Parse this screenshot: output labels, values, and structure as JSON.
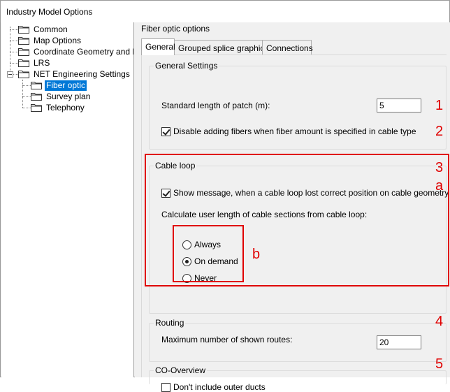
{
  "window": {
    "title": "Industry Model Options"
  },
  "tree": {
    "items": [
      {
        "label": "Common"
      },
      {
        "label": "Map Options"
      },
      {
        "label": "Coordinate Geometry and Dime"
      },
      {
        "label": "LRS"
      },
      {
        "label": "NET Engineering Settings"
      },
      {
        "label": "Fiber optic"
      },
      {
        "label": "Survey plan"
      },
      {
        "label": "Telephony"
      }
    ]
  },
  "pane": {
    "group_title": "Fiber optic options",
    "tabs": [
      {
        "label": "General"
      },
      {
        "label": "Grouped splice graphics"
      },
      {
        "label": "Connections"
      }
    ],
    "active_tab": "General"
  },
  "general_settings": {
    "title": "General Settings",
    "patch_length_label": "Standard length of patch (m):",
    "patch_length_value": "5",
    "disable_fibers_label": "Disable adding fibers when fiber amount is specified in cable type",
    "disable_fibers_checked": true
  },
  "cable_loop": {
    "title": "Cable loop",
    "show_message_label": "Show message, when a cable loop lost correct position on cable geometry",
    "show_message_checked": true,
    "calc_label": "Calculate user length of cable sections from cable loop:",
    "options": [
      {
        "label": "Always",
        "checked": false
      },
      {
        "label": "On demand",
        "checked": true
      },
      {
        "label": "Never",
        "checked": false
      }
    ]
  },
  "routing": {
    "title": "Routing",
    "max_routes_label": "Maximum number of shown routes:",
    "max_routes_value": "20"
  },
  "co_overview": {
    "title": "CO-Overview",
    "outer_ducts_label": "Don't include outer ducts",
    "outer_ducts_checked": false
  },
  "annotations": {
    "color": "#e00000",
    "markers": [
      "1",
      "2",
      "3",
      "a",
      "b",
      "4",
      "5"
    ]
  }
}
